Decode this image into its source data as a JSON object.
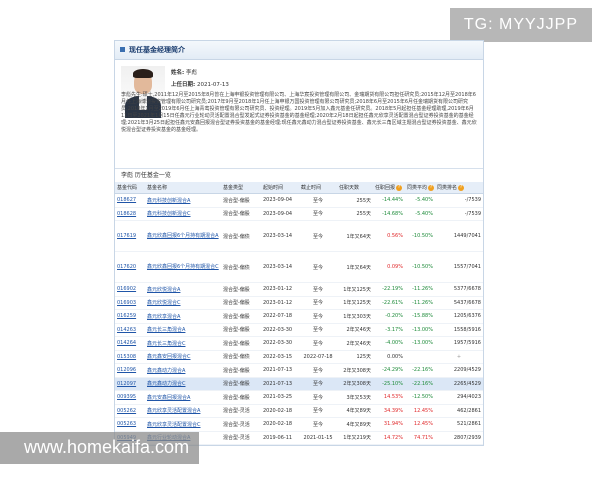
{
  "watermarks": {
    "top": "TG: MYYJJPP",
    "bottom": "www.homekaifa.com"
  },
  "panel": {
    "title": "现任基金经理简介"
  },
  "manager": {
    "name_label": "姓名:",
    "name": "李彪",
    "start_label": "上任日期:",
    "start_date": "2021-07-13",
    "bio": "李彪先生:硕士,2011年12月至2015年8月曾在上海申银投资管理有限公司、上海华宸投资管理有限公司、金瑞期货有限公司担任研究员;2015年12月至2018年6月任上海博道投资管理有限公司研究员;2017年9月至2018年1月任上海申银万国投资管理有限公司研究员;2018年6月至2015年6月任金瑞期货有限公司研究员;2018年1月至2019年6月任上海青鸾投资管理有限公司研究员、投资经理。2019年5月加入鑫元基金任研究员。2018年5月起担任基金经理助理,2019年6月11日至2021年1月15日任鑫元行业轮动灵活配置混合型发起式证券投资基金的基金经理;2020年2月18日起担任鑫元欣享灵活配置混合型证券投资基金的基金经理;2021年3月25日起担任鑫元安鑫回报混合型证券投资基金的基金经理;现任鑫元鑫动力混合型证券投资基金、鑫元长三角区域主题混合型证券投资基金、鑫元欣悦混合型证券投资基金的基金经理。"
  },
  "history": {
    "title": "李彪 历任基金一览",
    "columns": [
      "基金代码",
      "基金名称",
      "基金类型",
      "起始时间",
      "截止时间",
      "任职天数",
      "任职回报",
      "同类平均",
      "同类排名"
    ],
    "rows": [
      {
        "code": "018627",
        "name": "鑫元科技创新混合A",
        "type": "混合型-偏股",
        "start": "2023-09-04",
        "end": "至今",
        "days": "255天",
        "ret": "-14.44%",
        "avg": "-5.40%",
        "rank": "-/7539",
        "h": 1
      },
      {
        "code": "018628",
        "name": "鑫元科技创新混合C",
        "type": "混合型-偏股",
        "start": "2023-09-04",
        "end": "至今",
        "days": "255天",
        "ret": "-14.68%",
        "avg": "-5.40%",
        "rank": "-/7539",
        "h": 1
      },
      {
        "code": "017619",
        "name": "鑫元欣鑫回报6个月持有期混合A",
        "type": "混合型-偏债",
        "start": "2023-03-14",
        "end": "至今",
        "days": "1年又64天",
        "ret": "0.56%",
        "avg": "-10.50%",
        "rank": "1449/7041",
        "h": 3
      },
      {
        "code": "017620",
        "name": "鑫元欣鑫回报6个月持有期混合C",
        "type": "混合型-偏债",
        "start": "2023-03-14",
        "end": "至今",
        "days": "1年又64天",
        "ret": "0.09%",
        "avg": "-10.50%",
        "rank": "1557/7041",
        "h": 3
      },
      {
        "code": "016902",
        "name": "鑫元欣悦混合A",
        "type": "混合型-偏股",
        "start": "2023-01-12",
        "end": "至今",
        "days": "1年又125天",
        "ret": "-22.19%",
        "avg": "-11.26%",
        "rank": "5377/6678",
        "h": 1
      },
      {
        "code": "016903",
        "name": "鑫元欣悦混合C",
        "type": "混合型-偏股",
        "start": "2023-01-12",
        "end": "至今",
        "days": "1年又125天",
        "ret": "-22.61%",
        "avg": "-11.26%",
        "rank": "5437/6678",
        "h": 1
      },
      {
        "code": "016259",
        "name": "鑫元欣享混合A",
        "type": "混合型-偏股",
        "start": "2022-07-18",
        "end": "至今",
        "days": "1年又303天",
        "ret": "-0.20%",
        "avg": "-15.88%",
        "rank": "1205/6376",
        "h": 1
      },
      {
        "code": "014263",
        "name": "鑫元长三角混合A",
        "type": "混合型-偏股",
        "start": "2022-03-30",
        "end": "至今",
        "days": "2年又46天",
        "ret": "-3.17%",
        "avg": "-13.00%",
        "rank": "1558/5916",
        "h": 1
      },
      {
        "code": "014264",
        "name": "鑫元长三角混合C",
        "type": "混合型-偏股",
        "start": "2022-03-30",
        "end": "至今",
        "days": "2年又46天",
        "ret": "-4.00%",
        "avg": "-13.00%",
        "rank": "1957/5916",
        "h": 1
      },
      {
        "code": "015308",
        "name": "鑫元鑫安回报混合C",
        "type": "混合型-偏债",
        "start": "2022-03-15",
        "end": "2022-07-18",
        "days": "125天",
        "ret": "0.00%",
        "avg": "",
        "rank": "",
        "h": 1,
        "plus": true
      },
      {
        "code": "012096",
        "name": "鑫元鑫动力混合A",
        "type": "混合型-偏股",
        "start": "2021-07-13",
        "end": "至今",
        "days": "2年又308天",
        "ret": "-24.29%",
        "avg": "-22.16%",
        "rank": "2209/4529",
        "h": 1
      },
      {
        "code": "012097",
        "name": "鑫元鑫动力混合C",
        "type": "混合型-偏股",
        "start": "2021-07-13",
        "end": "至今",
        "days": "2年又308天",
        "ret": "-25.10%",
        "avg": "-22.16%",
        "rank": "2265/4529",
        "h": 1,
        "selected": true
      },
      {
        "code": "009395",
        "name": "鑫元安鑫回报混合A",
        "type": "混合型-偏股",
        "start": "2021-03-25",
        "end": "至今",
        "days": "3年又53天",
        "ret": "14.53%",
        "avg": "-12.50%",
        "rank": "294/4023",
        "h": 1
      },
      {
        "code": "005262",
        "name": "鑫元欣享灵活配置混合A",
        "type": "混合型-灵活",
        "start": "2020-02-18",
        "end": "至今",
        "days": "4年又89天",
        "ret": "34.39%",
        "avg": "12.45%",
        "rank": "462/2861",
        "h": 1
      },
      {
        "code": "005263",
        "name": "鑫元欣享灵活配置混合C",
        "type": "混合型-灵活",
        "start": "2020-02-18",
        "end": "至今",
        "days": "4年又89天",
        "ret": "31.94%",
        "avg": "12.45%",
        "rank": "521/2861",
        "h": 1
      },
      {
        "code": "005949",
        "name": "鑫元行业轮动混合A",
        "type": "混合型-灵活",
        "start": "2019-06-11",
        "end": "2021-01-15",
        "days": "1年又219天",
        "ret": "14.72%",
        "avg": "74.71%",
        "rank": "2807/2939",
        "h": 1
      },
      {
        "code": "005950",
        "name": "鑫元行业轮动混合C",
        "type": "混合型-灵活",
        "start": "2019-06-11",
        "end": "2021-01-15",
        "days": "1年又219天",
        "ret": "0.00%",
        "avg": "",
        "rank": "",
        "h": 1,
        "plus": true
      }
    ]
  },
  "colors": {
    "link": "#1f55a8",
    "positive": "#e0292b",
    "negative": "#1e8b3a",
    "header_bg": "#e6eef8",
    "selected_row": "#dbe7f6"
  }
}
